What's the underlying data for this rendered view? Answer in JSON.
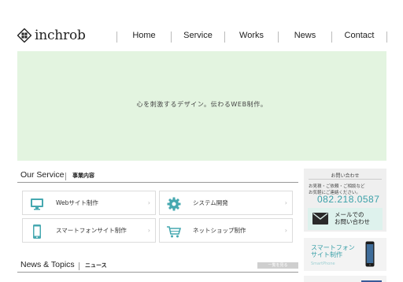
{
  "header": {
    "logo_text": "inchrob",
    "nav": [
      "Home",
      "Service",
      "Works",
      "News",
      "Contact"
    ]
  },
  "hero": {
    "tagline": "心を刺激するデザイン。伝わるWEB制作。",
    "bg_color": "#e3f4e0"
  },
  "service_section": {
    "title": "Our Service",
    "subtitle": "事業内容",
    "items": [
      {
        "label": "Webサイト制作",
        "icon": "monitor-icon"
      },
      {
        "label": "システム開発",
        "icon": "gear-icon"
      },
      {
        "label": "スマートフォンサイト制作",
        "icon": "smartphone-icon"
      },
      {
        "label": "ネットショップ制作",
        "icon": "cart-icon"
      }
    ]
  },
  "news_section": {
    "title": "News & Topics",
    "subtitle": "ニュース",
    "more_label": "一覧を見る"
  },
  "sidebar": {
    "contact_title": "お問い合わせ",
    "contact_desc_1": "お見積・ご依頼・ご相談など",
    "contact_desc_2": "お気軽にご連絡ください。",
    "phone": "082.218.0587",
    "mail_line_1": "メールでの",
    "mail_line_2": "お問い合わせ",
    "sp_line_1": "スマートフォン",
    "sp_line_2": "サイト制作",
    "sp_sub": "SmartPhone",
    "accent_color": "#3aa0a8"
  }
}
